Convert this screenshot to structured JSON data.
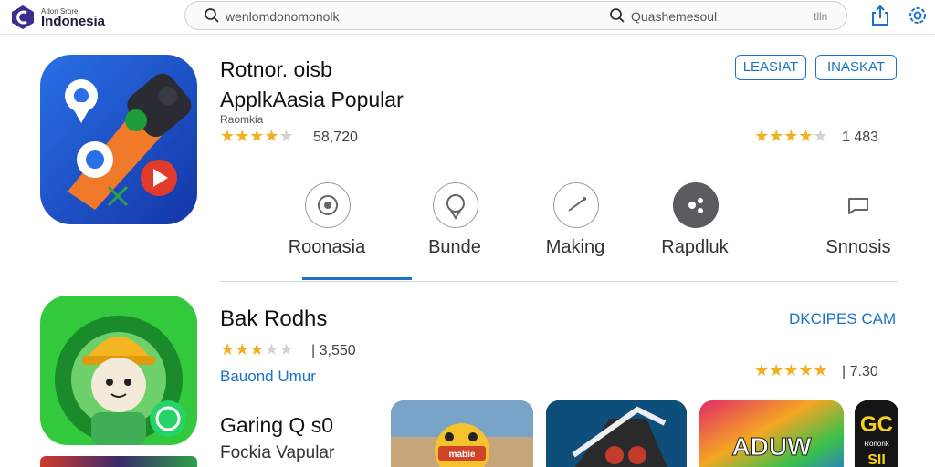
{
  "header": {
    "logo_top": "Adon Srore",
    "logo_main": "Indonesia",
    "search_value": "wenlomdonomonolk",
    "search_secondary": "Quashemesoul",
    "search_end": "tlln",
    "icons": [
      "share-icon",
      "settings-icon"
    ]
  },
  "featured": {
    "title_line1": "Rotnor. oisb",
    "title_line2": "ApplkAasia Popular",
    "subtitle": "Raomkia",
    "rating_left": "58,720",
    "rating_left_stars": 4,
    "rating_right": "1 483",
    "rating_right_stars": 4,
    "buttons": [
      "LEASIAT",
      "INASKAT"
    ],
    "categories": [
      {
        "label": "Roonasia",
        "icon": "camera-icon"
      },
      {
        "label": "Bunde",
        "icon": "location-icon"
      },
      {
        "label": "Making",
        "icon": "tools-icon"
      },
      {
        "label": "Rapdluk",
        "icon": "game-icon"
      },
      {
        "label": "Snnosis",
        "icon": "chat-icon"
      }
    ],
    "selected_category_index": 0
  },
  "second": {
    "title": "Bak Rodhs",
    "rating": "| 3,550",
    "rating_stars": 3,
    "link": "Bauond Umur",
    "right_link": "DKCIPES CAM",
    "right_rating": "| 7.30",
    "right_rating_stars": 5,
    "title2": "Garing Q s0",
    "subtitle2": "Fockia Vapular",
    "thumbs": [
      {
        "text": "mabie"
      },
      {
        "text": ""
      },
      {
        "text": "ADUW"
      },
      {
        "text": "GC",
        "subtext": "Ronorik",
        "subtext2": "SII"
      }
    ]
  },
  "colors": {
    "accent": "#1a73c8",
    "star": "#f2b01e",
    "star_off": "#d3d3d3"
  }
}
